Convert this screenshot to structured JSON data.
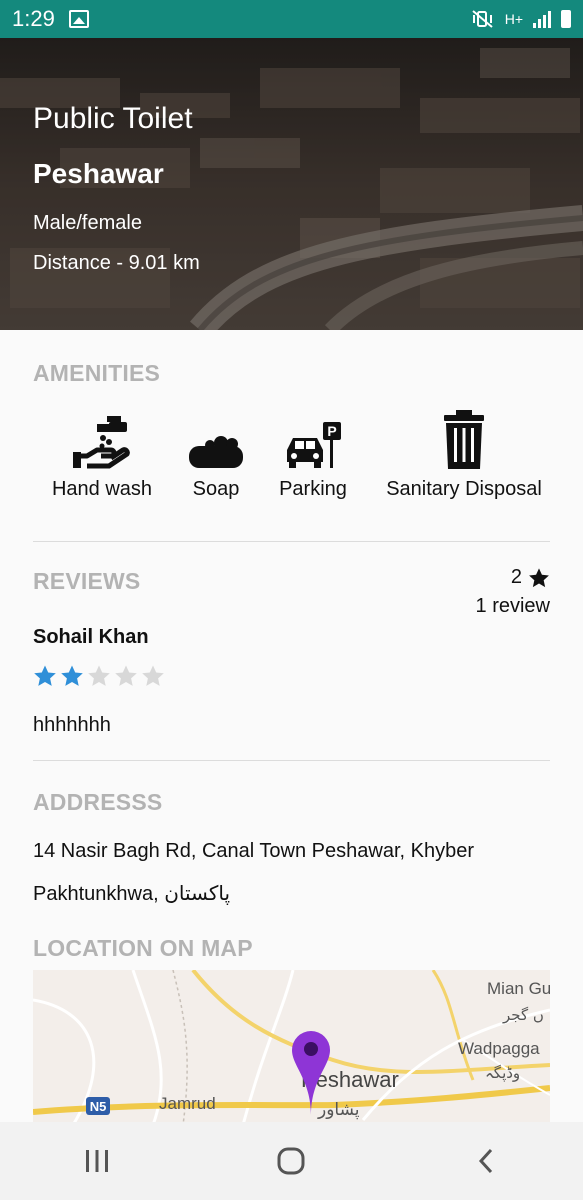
{
  "status_bar": {
    "time": "1:29",
    "network_label": "H+",
    "icons": [
      "image-icon",
      "mute-vibrate-icon",
      "signal-icon",
      "battery-icon"
    ]
  },
  "header": {
    "place_type": "Public Toilet",
    "city": "Peshawar",
    "gender": "Male/female",
    "distance": "Distance - 9.01 km"
  },
  "amenities": {
    "title": "AMENITIES",
    "items": [
      {
        "label": "Hand wash",
        "icon": "hand-wash-icon"
      },
      {
        "label": "Soap",
        "icon": "soap-icon"
      },
      {
        "label": "Parking",
        "icon": "parking-icon"
      },
      {
        "label": "Sanitary Disposal",
        "icon": "trash-bin-icon"
      }
    ]
  },
  "reviews": {
    "title": "REVIEWS",
    "average": "2",
    "count_label": "1 review",
    "items": [
      {
        "author": "Sohail Khan",
        "rating": 2,
        "max_rating": 5,
        "text": "hhhhhhh"
      }
    ]
  },
  "address": {
    "title": "ADDRESSS",
    "line1": "14 Nasir Bagh Rd, Canal Town Peshawar, Khyber",
    "line2": "Pakhtunkhwa, پاکستان"
  },
  "map": {
    "title": "LOCATION ON MAP",
    "labels": {
      "city": "Peshawar",
      "city_urdu": "پشاور",
      "mian": "Mian Gu",
      "mian_urdu": "ں گجر",
      "wadpagga": "Wadpagga",
      "wadpagga_urdu": "وڈپگہ",
      "jamrud": "Jamrud",
      "highway": "N5"
    }
  },
  "colors": {
    "status_bar": "#14897d",
    "star_filled": "#2f8fd8",
    "star_empty": "#d8d8d8",
    "section_title": "#b3b3b3",
    "map_pin": "#8e35d6"
  }
}
